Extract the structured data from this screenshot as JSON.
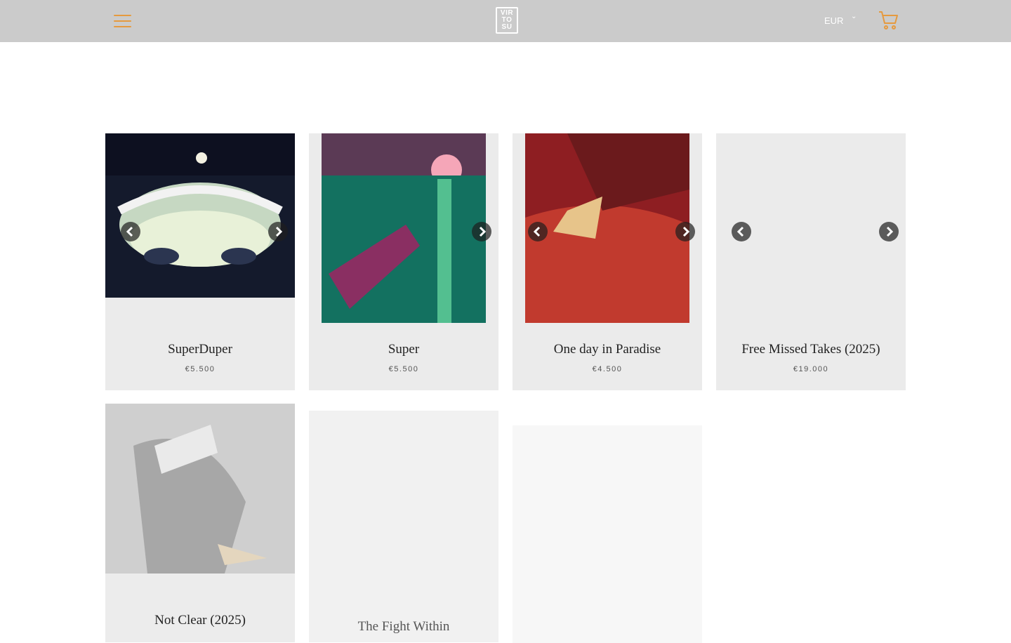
{
  "header": {
    "logo_lines": [
      "VIR",
      "TO",
      "SU"
    ],
    "currency": "EUR",
    "icons": {
      "menu": "hamburger-menu-icon",
      "currency_dropdown": "chevron-down-icon",
      "cart": "shopping-cart-icon"
    },
    "colors": {
      "background": "#cbcbcb",
      "accent": "#e59a3f"
    }
  },
  "products": [
    {
      "title": "SuperDuper",
      "price": "€5.500"
    },
    {
      "title": "Super",
      "price": "€5.500"
    },
    {
      "title": "One day in Paradise",
      "price": "€4.500"
    },
    {
      "title": "Free Missed Takes (2025)",
      "price": "€19.000"
    },
    {
      "title": "Not Clear (2025)",
      "price": ""
    },
    {
      "title": "The Fight Within",
      "price": ""
    }
  ],
  "carousel_icons": {
    "prev": "chevron-left-icon",
    "next": "chevron-right-icon"
  }
}
